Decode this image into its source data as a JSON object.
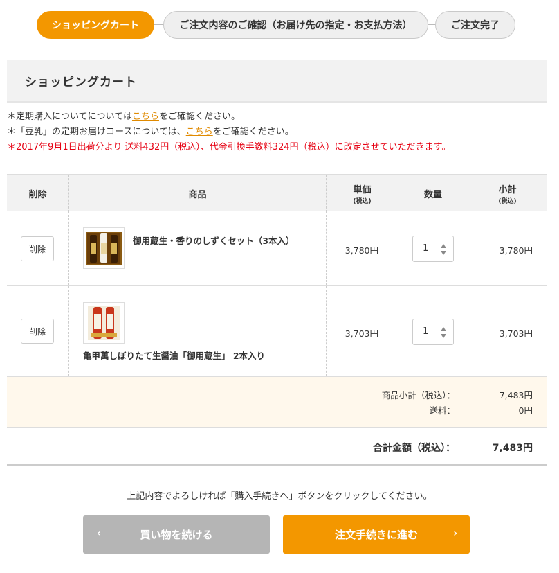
{
  "steps": [
    {
      "label": "ショッピングカート",
      "active": true
    },
    {
      "label": "ご注文内容のご確認（お届け先の指定・お支払方法）",
      "active": false
    },
    {
      "label": "ご注文完了",
      "active": false
    }
  ],
  "heading": "ショッピングカート",
  "notices": {
    "line1_pre": "＊定期購入についてについては",
    "line1_link": "こちら",
    "line1_post": "をご確認ください。",
    "line2_pre": "＊「豆乳」の定期お届けコースについては、",
    "line2_link": "こちら",
    "line2_post": "をご確認ください。",
    "line3": "＊2017年9月1日出荷分より 送料432円（税込）、代金引換手数料324円（税込）に改定させていただきます。"
  },
  "table": {
    "headers": {
      "delete": "削除",
      "product": "商品",
      "unit_price": "単価",
      "unit_price_note": "(税込)",
      "quantity": "数量",
      "subtotal": "小計",
      "subtotal_note": "(税込)"
    },
    "items": [
      {
        "delete_label": "削除",
        "name": "御用蔵生・香りのしずくセット（3本入）",
        "unit_price": "3,780円",
        "quantity": "1",
        "subtotal": "3,780円"
      },
      {
        "delete_label": "削除",
        "name": "亀甲萬しぼりたて生醤油「御用蔵生」 2本入り",
        "unit_price": "3,703円",
        "quantity": "1",
        "subtotal": "3,703円"
      }
    ]
  },
  "totals": {
    "items_subtotal_label": "商品小計（税込）：",
    "items_subtotal_value": "7,483円",
    "shipping_label": "送料：",
    "shipping_value": "0円",
    "grand_label": "合計金額（税込）：",
    "grand_value": "7,483円"
  },
  "instruction": "上記内容でよろしければ「購入手続きへ」ボタンをクリックしてください。",
  "buttons": {
    "back": "買い物を続ける",
    "next": "注文手続きに進む"
  },
  "colors": {
    "accent": "#f39700",
    "link": "#e08a00",
    "warning": "#e60012",
    "secondary_button": "#b5b5b5",
    "totals_background": "#fff8ec"
  },
  "icons": [
    "chevron-left-icon",
    "chevron-right-icon",
    "spinner-arrows-icon"
  ]
}
